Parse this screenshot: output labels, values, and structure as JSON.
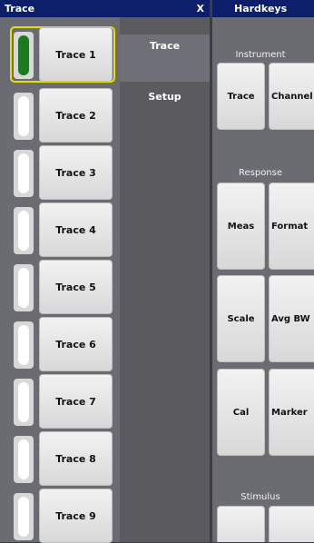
{
  "trace_panel": {
    "title": "Trace",
    "close_label": "X",
    "traces": [
      {
        "label": "Trace 1",
        "active": true
      },
      {
        "label": "Trace 2",
        "active": false
      },
      {
        "label": "Trace 3",
        "active": false
      },
      {
        "label": "Trace 4",
        "active": false
      },
      {
        "label": "Trace 5",
        "active": false
      },
      {
        "label": "Trace 6",
        "active": false
      },
      {
        "label": "Trace 7",
        "active": false
      },
      {
        "label": "Trace 8",
        "active": false
      },
      {
        "label": "Trace 9",
        "active": false
      }
    ],
    "tabs": [
      {
        "label": "Trace",
        "selected": true
      },
      {
        "label": "Setup",
        "selected": false
      }
    ]
  },
  "hardkeys_panel": {
    "title": "Hardkeys",
    "sections": {
      "instrument": "Instrument",
      "response": "Response",
      "stimulus": "Stimulus"
    },
    "buttons": {
      "trace": "Trace",
      "channel": "Channel",
      "meas": "Meas",
      "format": "Format",
      "scale": "Scale",
      "avg_bw": "Avg BW",
      "cal": "Cal",
      "marker": "Marker"
    }
  },
  "colors": {
    "titlebar": "#0d1f6a",
    "active_indicator": "#1b7a1b",
    "selection_outline": "#e8e000"
  }
}
